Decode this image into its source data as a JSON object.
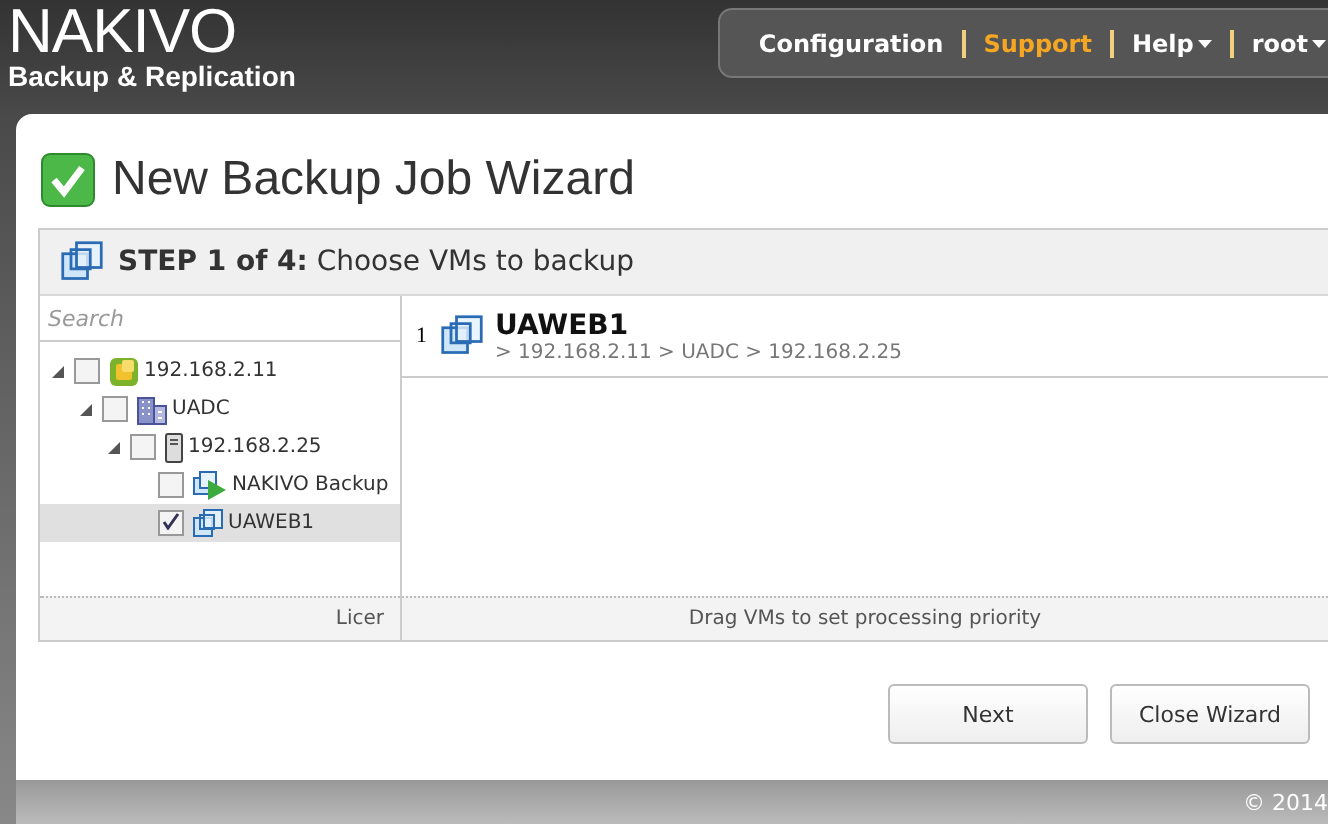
{
  "header": {
    "logo": {
      "name": "NAKIVO",
      "subtitle": "Backup & Replication"
    },
    "nav": [
      {
        "label": "Configuration",
        "selected": false,
        "dropdown": false
      },
      {
        "label": "Support",
        "selected": true,
        "dropdown": false
      },
      {
        "label": "Help",
        "selected": false,
        "dropdown": true
      },
      {
        "label": "root",
        "selected": false,
        "dropdown": true
      }
    ]
  },
  "wizard": {
    "title": "New Backup Job Wizard",
    "step": "**STEP 1 of 4:** Choose VMs to backup",
    "search": {
      "placeholder": "Search"
    },
    "tree": [
      {
        "label": "192.168.2.11",
        "kind": "host",
        "checked": false,
        "expanded": true,
        "selected": false,
        "children": [
          {
            "label": "UADC",
            "kind": "datacenter",
            "checked": false,
            "expanded": true,
            "selected": false,
            "children": [
              {
                "label": "192.168.2.25",
                "kind": "server",
                "checked": false,
                "expanded": true,
                "selected": false,
                "children": [
                  {
                    "label": "NAKIVO Backup",
                    "kind": "appliance",
                    "checked": false,
                    "selected": false
                  },
                  {
                    "label": "UAWEB1",
                    "kind": "vm",
                    "checked": true,
                    "selected": true
                  }
                ]
              }
            ]
          }
        ]
      }
    ],
    "tree_footer": "Licer",
    "selected_vms": [
      {
        "index": "1",
        "name": "UAWEB1",
        "path": "> 192.168.2.11 > UADC > 192.168.2.25"
      }
    ],
    "list_footer": "Drag VMs to set processing priority",
    "buttons": [
      "Next",
      "Close Wizard"
    ]
  },
  "footer": {
    "copyright": "© 2014"
  }
}
